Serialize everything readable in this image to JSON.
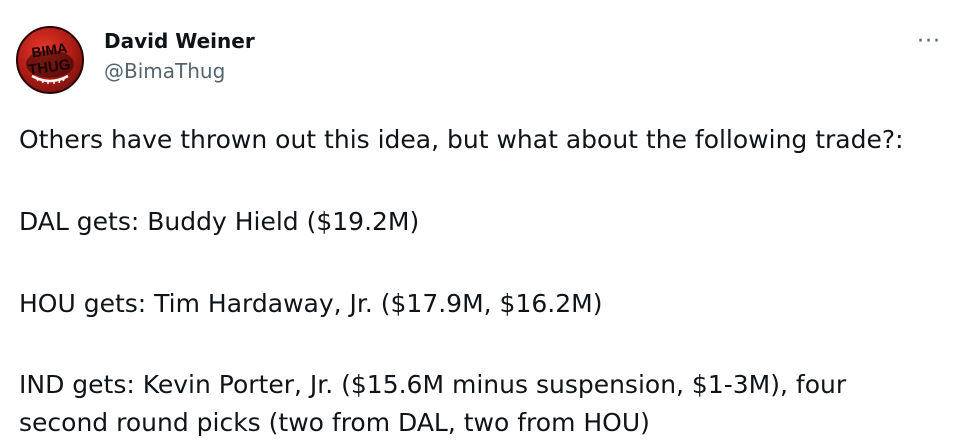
{
  "tweet": {
    "author": {
      "display_name": "David Weiner",
      "handle": "@BimaThug",
      "avatar_text": "BIMA THUG"
    },
    "more_icon": "···",
    "body": {
      "line1": "Others have thrown out this idea, but what about the following trade?:",
      "line2": "DAL gets: Buddy Hield ($19.2M)",
      "line3": "HOU gets: Tim Hardaway, Jr. ($17.9M, $16.2M)",
      "line4a": "IND gets: Kevin Porter, Jr. ($15.6M minus suspension, $1-3M), four",
      "line4b": "second round picks (two from DAL, two from HOU)"
    }
  },
  "colors": {
    "text": "#0f1419",
    "secondary": "#536471",
    "avatar_red": "#b51f17"
  }
}
